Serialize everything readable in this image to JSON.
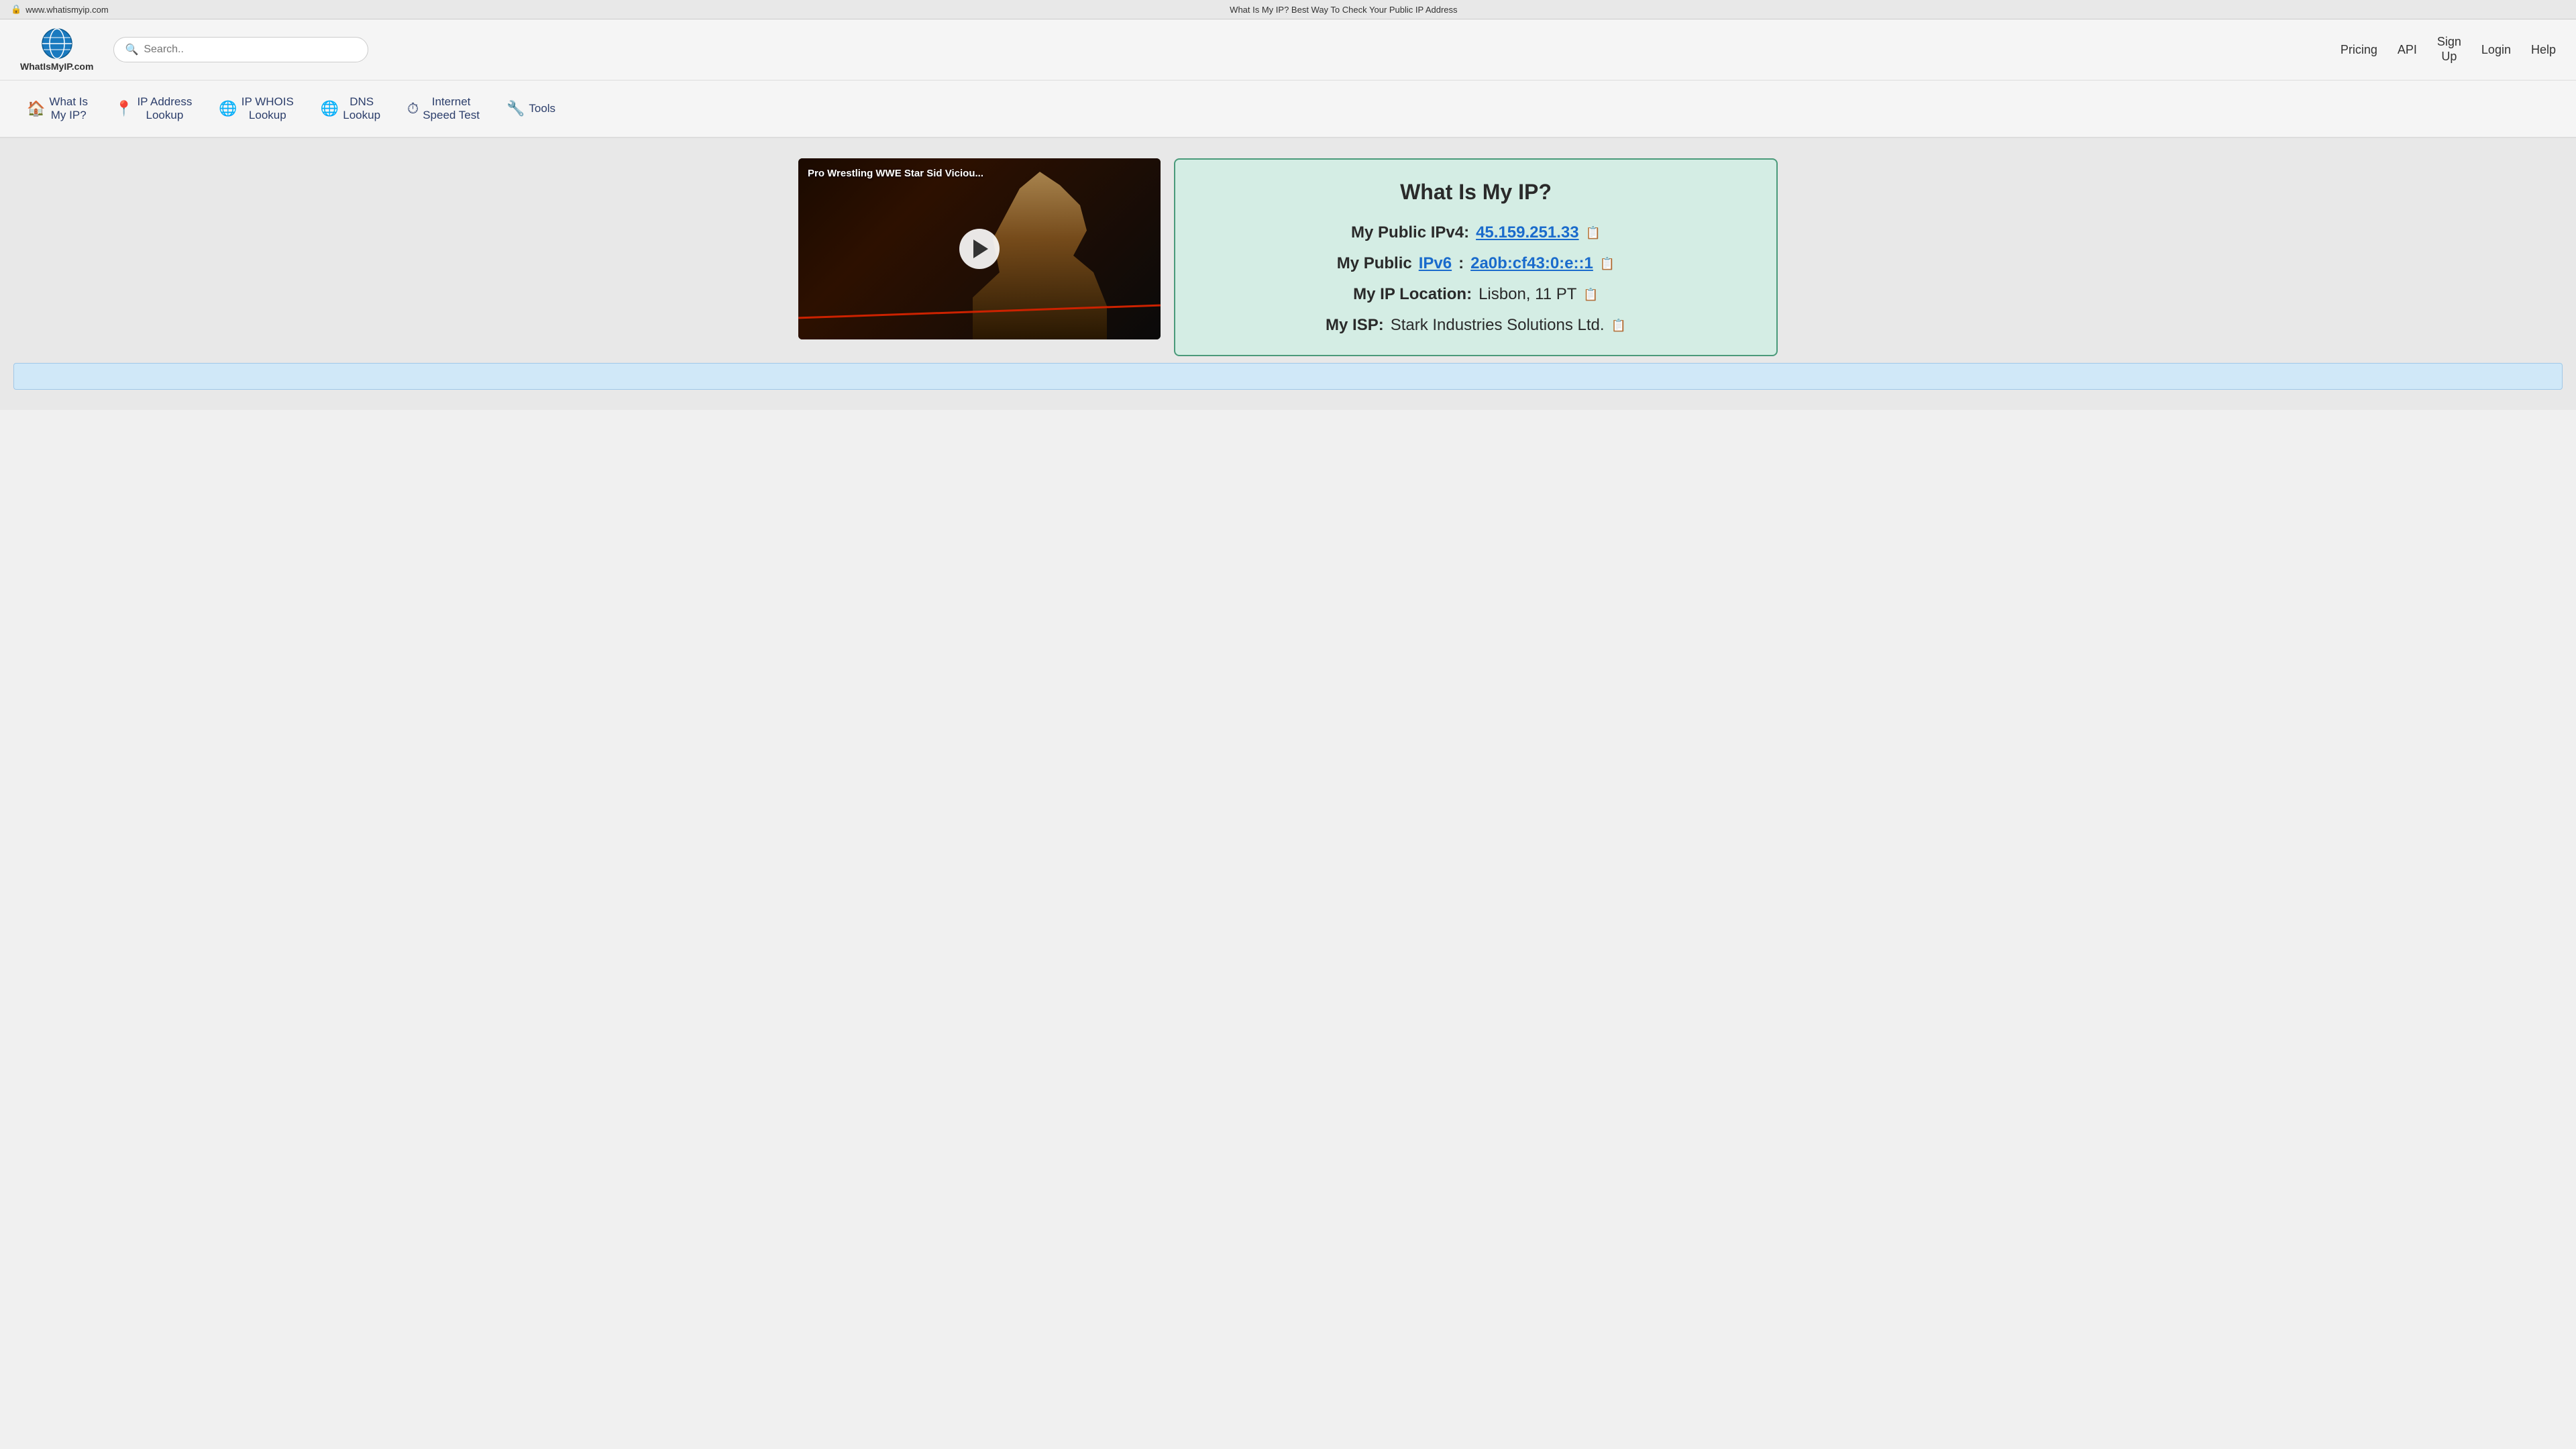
{
  "browser": {
    "lock_icon": "🔒",
    "url": "www.whatismyip.com",
    "page_title": "What Is My IP? Best Way To Check Your Public IP Address"
  },
  "header": {
    "logo_text": "WhatIsMyIP.com",
    "search_placeholder": "Search..",
    "nav": {
      "pricing": "Pricing",
      "api": "API",
      "sign_up_line1": "Sign",
      "sign_up_line2": "Up",
      "login": "Login",
      "help": "Help"
    }
  },
  "sub_nav": [
    {
      "id": "what-is-my-ip",
      "icon": "🏠",
      "label": "What Is\nMy IP?"
    },
    {
      "id": "ip-address-lookup",
      "icon": "📍",
      "label": "IP Address\nLookup"
    },
    {
      "id": "ip-whois-lookup",
      "icon": "🌐",
      "label": "IP WHOIS\nLookup"
    },
    {
      "id": "dns-lookup",
      "icon": "🌐",
      "label": "DNS\nLookup"
    },
    {
      "id": "internet-speed-test",
      "icon": "⏱",
      "label": "Internet\nSpeed Test"
    },
    {
      "id": "tools",
      "icon": "🔧",
      "label": "Tools"
    }
  ],
  "video": {
    "label": "Pro Wrestling WWE Star Sid Viciou...",
    "play_label": "Play"
  },
  "ip_info": {
    "title": "What Is My IP?",
    "ipv4_label": "My Public IPv4:",
    "ipv4_value": "45.159.251.33",
    "ipv6_label": "My Public",
    "ipv6_link": "IPv6",
    "ipv6_colon": ":",
    "ipv6_value": "2a0b:cf43:0:e::1",
    "location_label": "My IP Location:",
    "location_value": "Lisbon, 11 PT",
    "isp_label": "My ISP:",
    "isp_value": "Stark Industries Solutions Ltd."
  }
}
